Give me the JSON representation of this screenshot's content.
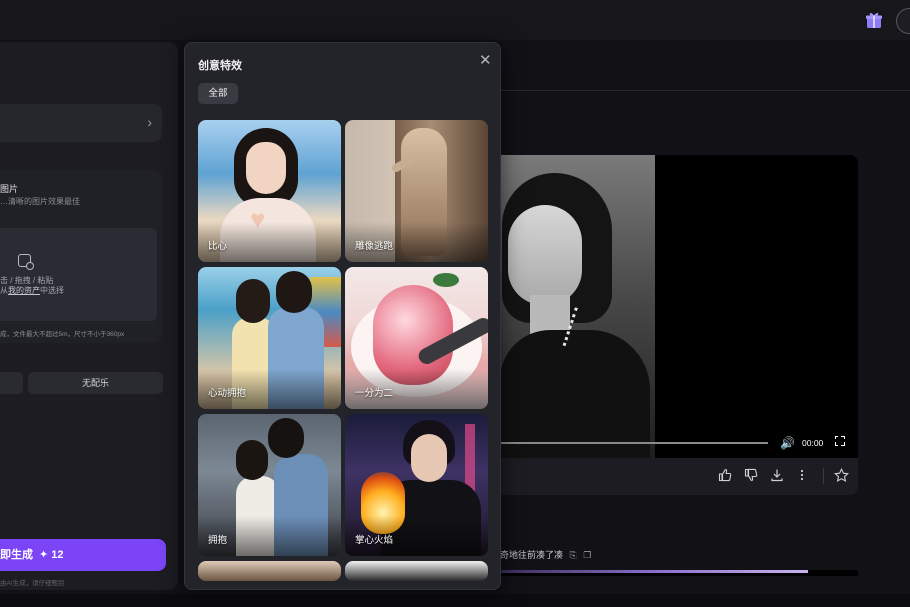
{
  "left_panel": {
    "upload_title": "图片",
    "upload_hint": "…清晰的图片效果最佳",
    "upload_zone_line1": "击 / 拖拽 / 粘贴",
    "upload_zone_line2_prefix": "从",
    "upload_zone_link": "我的资产",
    "upload_zone_line2_suffix": "中选择",
    "upload_limits": "成，文件最大不超过5m，尺寸不小于360px",
    "music_none": "无配乐",
    "generate_label": "即生成",
    "generate_cost": "12",
    "generate_note": "由AI生成，请仔细甄别"
  },
  "modal": {
    "title": "创意特效",
    "filter_all": "全部",
    "effects": [
      {
        "label": "比心"
      },
      {
        "label": "雕像逃跑"
      },
      {
        "label": "心动拥抱"
      },
      {
        "label": "一分为二"
      },
      {
        "label": "拥抱"
      },
      {
        "label": "掌心火焰"
      }
    ]
  },
  "player": {
    "time": "00:00",
    "progress": 0.0
  },
  "result": {
    "caption": "奇地往前凑了凑"
  },
  "colors": {
    "accent": "#7b45f6",
    "panel_bg": "#1c1c22",
    "modal_bg": "#23232a",
    "page_bg": "#111116"
  },
  "icons": {
    "gift": "gift-icon",
    "close": "close-icon",
    "upload": "image-upload-icon",
    "spark": "sparkle-icon",
    "volume": "volume-icon",
    "fullscreen": "fullscreen-icon",
    "like": "thumbs-up-icon",
    "dislike": "thumbs-down-icon",
    "download": "download-icon",
    "more": "more-vertical-icon",
    "favorite": "star-icon"
  }
}
